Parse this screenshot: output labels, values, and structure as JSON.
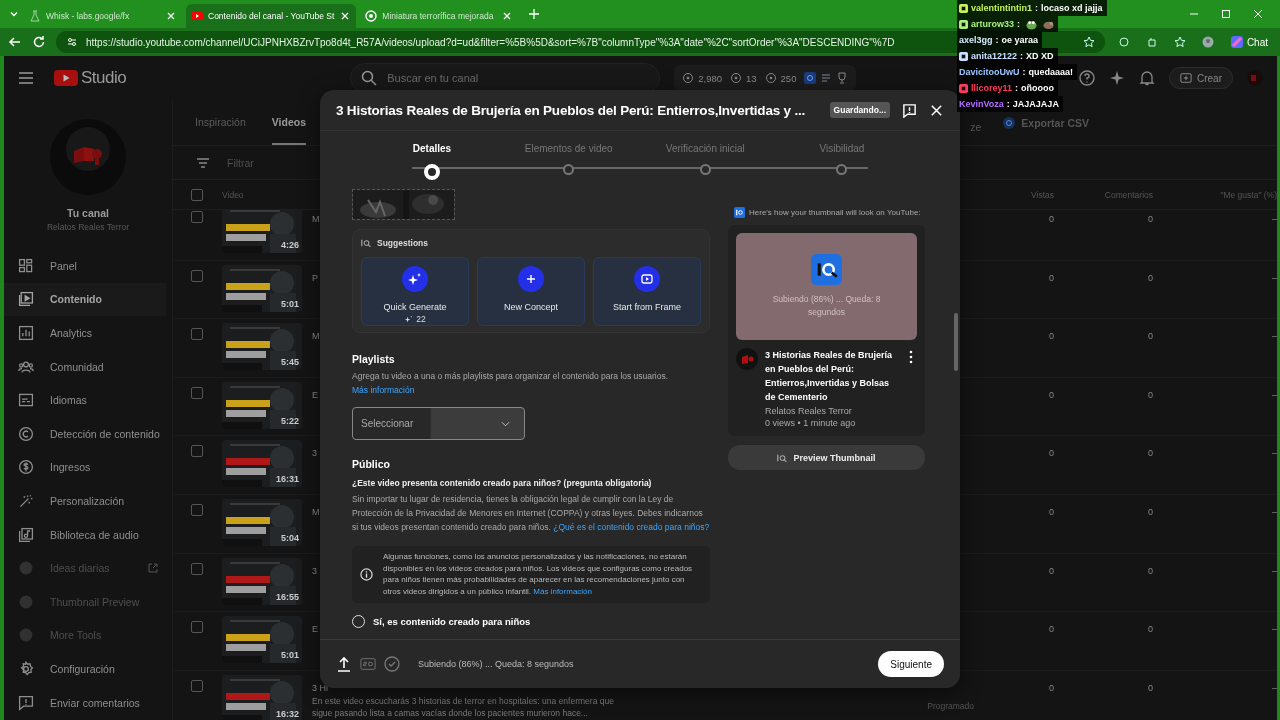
{
  "browser": {
    "tabs": [
      {
        "title": "Whisk - labs.google/fx",
        "selected": false,
        "kind": "flask"
      },
      {
        "title": "Contenido del canal - YouTube St",
        "selected": true,
        "kind": "youtube"
      },
      {
        "title": "Miniatura terrorífica mejorada",
        "selected": false,
        "kind": "chat"
      }
    ],
    "url": "https://studio.youtube.com/channel/UCiJPNHXBZrvTpo8d4t_R57A/videos/upload?d=ud&filter=%5B%5D&sort=%7B\"columnType\"%3A\"date\"%2C\"sortOrder\"%3A\"DESCENDING\"%7D",
    "chat_button": "Chat"
  },
  "chat_overlay": [
    {
      "user": "valentintintin1",
      "color": "#c6f25a",
      "badge": true,
      "separator": ":",
      "kind": "text",
      "message": "locaso xd jajja"
    },
    {
      "user": "arturow33",
      "color": "#a8f07a",
      "badge": true,
      "separator": ":",
      "kind": "emotes"
    },
    {
      "user": "axel3gg",
      "color": "#d8ecff",
      "badge": false,
      "separator": ":",
      "kind": "text",
      "message": "oe yaraa"
    },
    {
      "user": "anita12122",
      "color": "#c8e0ff",
      "badge": true,
      "separator": ":",
      "kind": "text",
      "message": "XD XD"
    },
    {
      "user": "DavicitooUwU",
      "color": "#9cc4ff",
      "badge": false,
      "separator": ":",
      "kind": "text",
      "message": "quedaaaa!"
    },
    {
      "user": "llicorey11",
      "color": "#ff3b5c",
      "badge": true,
      "separator": ":",
      "kind": "text",
      "message": "oñoooo"
    },
    {
      "user": "KevinVoza",
      "color": "#b46cff",
      "badge": false,
      "separator": ":",
      "kind": "text",
      "message": "JAJAJAJA"
    }
  ],
  "studio": {
    "logo": "Studio",
    "search_placeholder": "Buscar en tu canal",
    "stats": [
      "2,980",
      "13",
      "250"
    ],
    "create": "Crear",
    "channel": {
      "label": "Tu canal",
      "name": "Relatos Reales Terror"
    },
    "nav": [
      {
        "label": "Panel",
        "kind": "dashboard",
        "selected": false,
        "disabled": false
      },
      {
        "label": "Contenido",
        "kind": "content",
        "selected": true,
        "disabled": false
      },
      {
        "label": "Analytics",
        "kind": "analytics",
        "selected": false,
        "disabled": false
      },
      {
        "label": "Comunidad",
        "kind": "community",
        "selected": false,
        "disabled": false
      },
      {
        "label": "Idiomas",
        "kind": "subtitles",
        "selected": false,
        "disabled": false
      },
      {
        "label": "Detección de contenido",
        "kind": "copyright",
        "selected": false,
        "disabled": false
      },
      {
        "label": "Ingresos",
        "kind": "money",
        "selected": false,
        "disabled": false
      },
      {
        "label": "Personalización",
        "kind": "wand",
        "selected": false,
        "disabled": false
      },
      {
        "label": "Biblioteca de audio",
        "kind": "audio",
        "selected": false,
        "disabled": false
      },
      {
        "label": "Ideas diarias",
        "kind": "plugin",
        "selected": false,
        "disabled": true,
        "external": true
      },
      {
        "label": "Thumbnail Preview",
        "kind": "plugin",
        "selected": false,
        "disabled": true
      },
      {
        "label": "More Tools",
        "kind": "plugin",
        "selected": false,
        "disabled": true
      },
      {
        "label": "Configuración",
        "kind": "settings",
        "selected": false,
        "disabled": false
      },
      {
        "label": "Enviar comentarios",
        "kind": "feedback",
        "selected": false,
        "disabled": false
      }
    ],
    "tabs": [
      {
        "label": "Inspiración",
        "selected": false
      },
      {
        "label": "Videos",
        "selected": true
      }
    ],
    "toolbar_fragment": "ze",
    "export": "Exportar CSV",
    "filter_placeholder": "Filtrar",
    "columns": [
      "Video",
      "Vistas",
      "Comentarios",
      "\"Me gusta\" (%)"
    ],
    "select_all_checked": false,
    "rows": [
      {
        "title": "M",
        "checked": false,
        "duration": "4:26",
        "views": "0",
        "comments": "0",
        "likes": "–"
      },
      {
        "title": "P",
        "checked": false,
        "duration": "5:01",
        "views": "0",
        "comments": "0",
        "likes": "–"
      },
      {
        "title": "M",
        "checked": false,
        "duration": "5:45",
        "views": "0",
        "comments": "0",
        "likes": "–"
      },
      {
        "title": "E",
        "checked": false,
        "duration": "5:22",
        "views": "0",
        "comments": "0",
        "likes": "–"
      },
      {
        "title": "3",
        "checked": false,
        "duration": "16:31",
        "views": "0",
        "comments": "0",
        "likes": "–"
      },
      {
        "title": "M",
        "checked": false,
        "duration": "5:04",
        "views": "0",
        "comments": "0",
        "likes": "–"
      },
      {
        "title": "3",
        "checked": false,
        "duration": "16:55",
        "views": "0",
        "comments": "0",
        "likes": "–"
      },
      {
        "title": "E",
        "checked": false,
        "duration": "5:01",
        "views": "0",
        "comments": "0",
        "likes": "–"
      },
      {
        "title": "3 Hi",
        "checked": false,
        "duration": "16:32",
        "views": "0",
        "comments": "0",
        "likes": "–",
        "description": "En este video escucharás 3 historias de terror en hospitales: una enfermera que sigue pasando lista a camas vacías donde los pacientes murieron hace...",
        "status": "Programado"
      }
    ]
  },
  "dialog": {
    "title": "3 Historias Reales de Brujería en Pueblos del Perú: Entierros,Invertidas y ...",
    "status_badge": "Guardando...",
    "steps": [
      {
        "label": "Detalles",
        "selected": true
      },
      {
        "label": "Elementos de video",
        "selected": false
      },
      {
        "label": "Verificación inicial",
        "selected": false
      },
      {
        "label": "Visibilidad",
        "selected": false
      }
    ],
    "suggestions": {
      "title": "Suggestions",
      "cards": [
        {
          "kind": "sparkle",
          "label": "Quick Generate",
          "credits": "22"
        },
        {
          "kind": "plus",
          "label": "New Concept"
        },
        {
          "kind": "frame",
          "label": "Start from Frame"
        }
      ]
    },
    "playlists": {
      "heading": "Playlists",
      "description": "Agrega tu video a una o más playlists para organizar el contenido para los usuarios.",
      "link": "Más información",
      "placeholder": "Seleccionar"
    },
    "audience": {
      "heading": "Público",
      "question": "¿Este video presenta contenido creado para niños? (pregunta obligatoria)",
      "description": "Sin importar tu lugar de residencia, tienes la obligación legal de cumplir con la Ley de Protección de la Privacidad de Menores en Internet (COPPA) y otras leyes. Debes indicarnos si tus videos presentan contenido creado para niños.",
      "link": "¿Qué es el contenido creado para niños?",
      "info": "Algunas funciones, como los anuncios personalizados y las notificaciones, no estarán disponibles en los videos creados para niños. Los videos que configuras como creados para niños tienen más probabilidades de aparecer en las recomendaciones junto con otros videos dirigidos a un público infantil.",
      "info_link": "Más información",
      "options": [
        {
          "label": "Sí, es contenido creado para niños",
          "selected": false
        }
      ]
    },
    "preview": {
      "caption": "Here's how your thumbnail will look on YouTube:",
      "uploading": "Subiendo (86%) ... Queda: 8 segundos",
      "video_title": "3 Historias Reales de Brujería en Pueblos del Perú: Entierros,Invertidas y Bolsas de Cementerio",
      "channel": "Relatos Reales Terror",
      "meta": "0 views • 1 minute ago",
      "button": "Preview Thumbnail"
    },
    "footer": {
      "status": "Subiendo (86%) ... Queda: 8 segundos",
      "next": "Siguiente"
    }
  }
}
